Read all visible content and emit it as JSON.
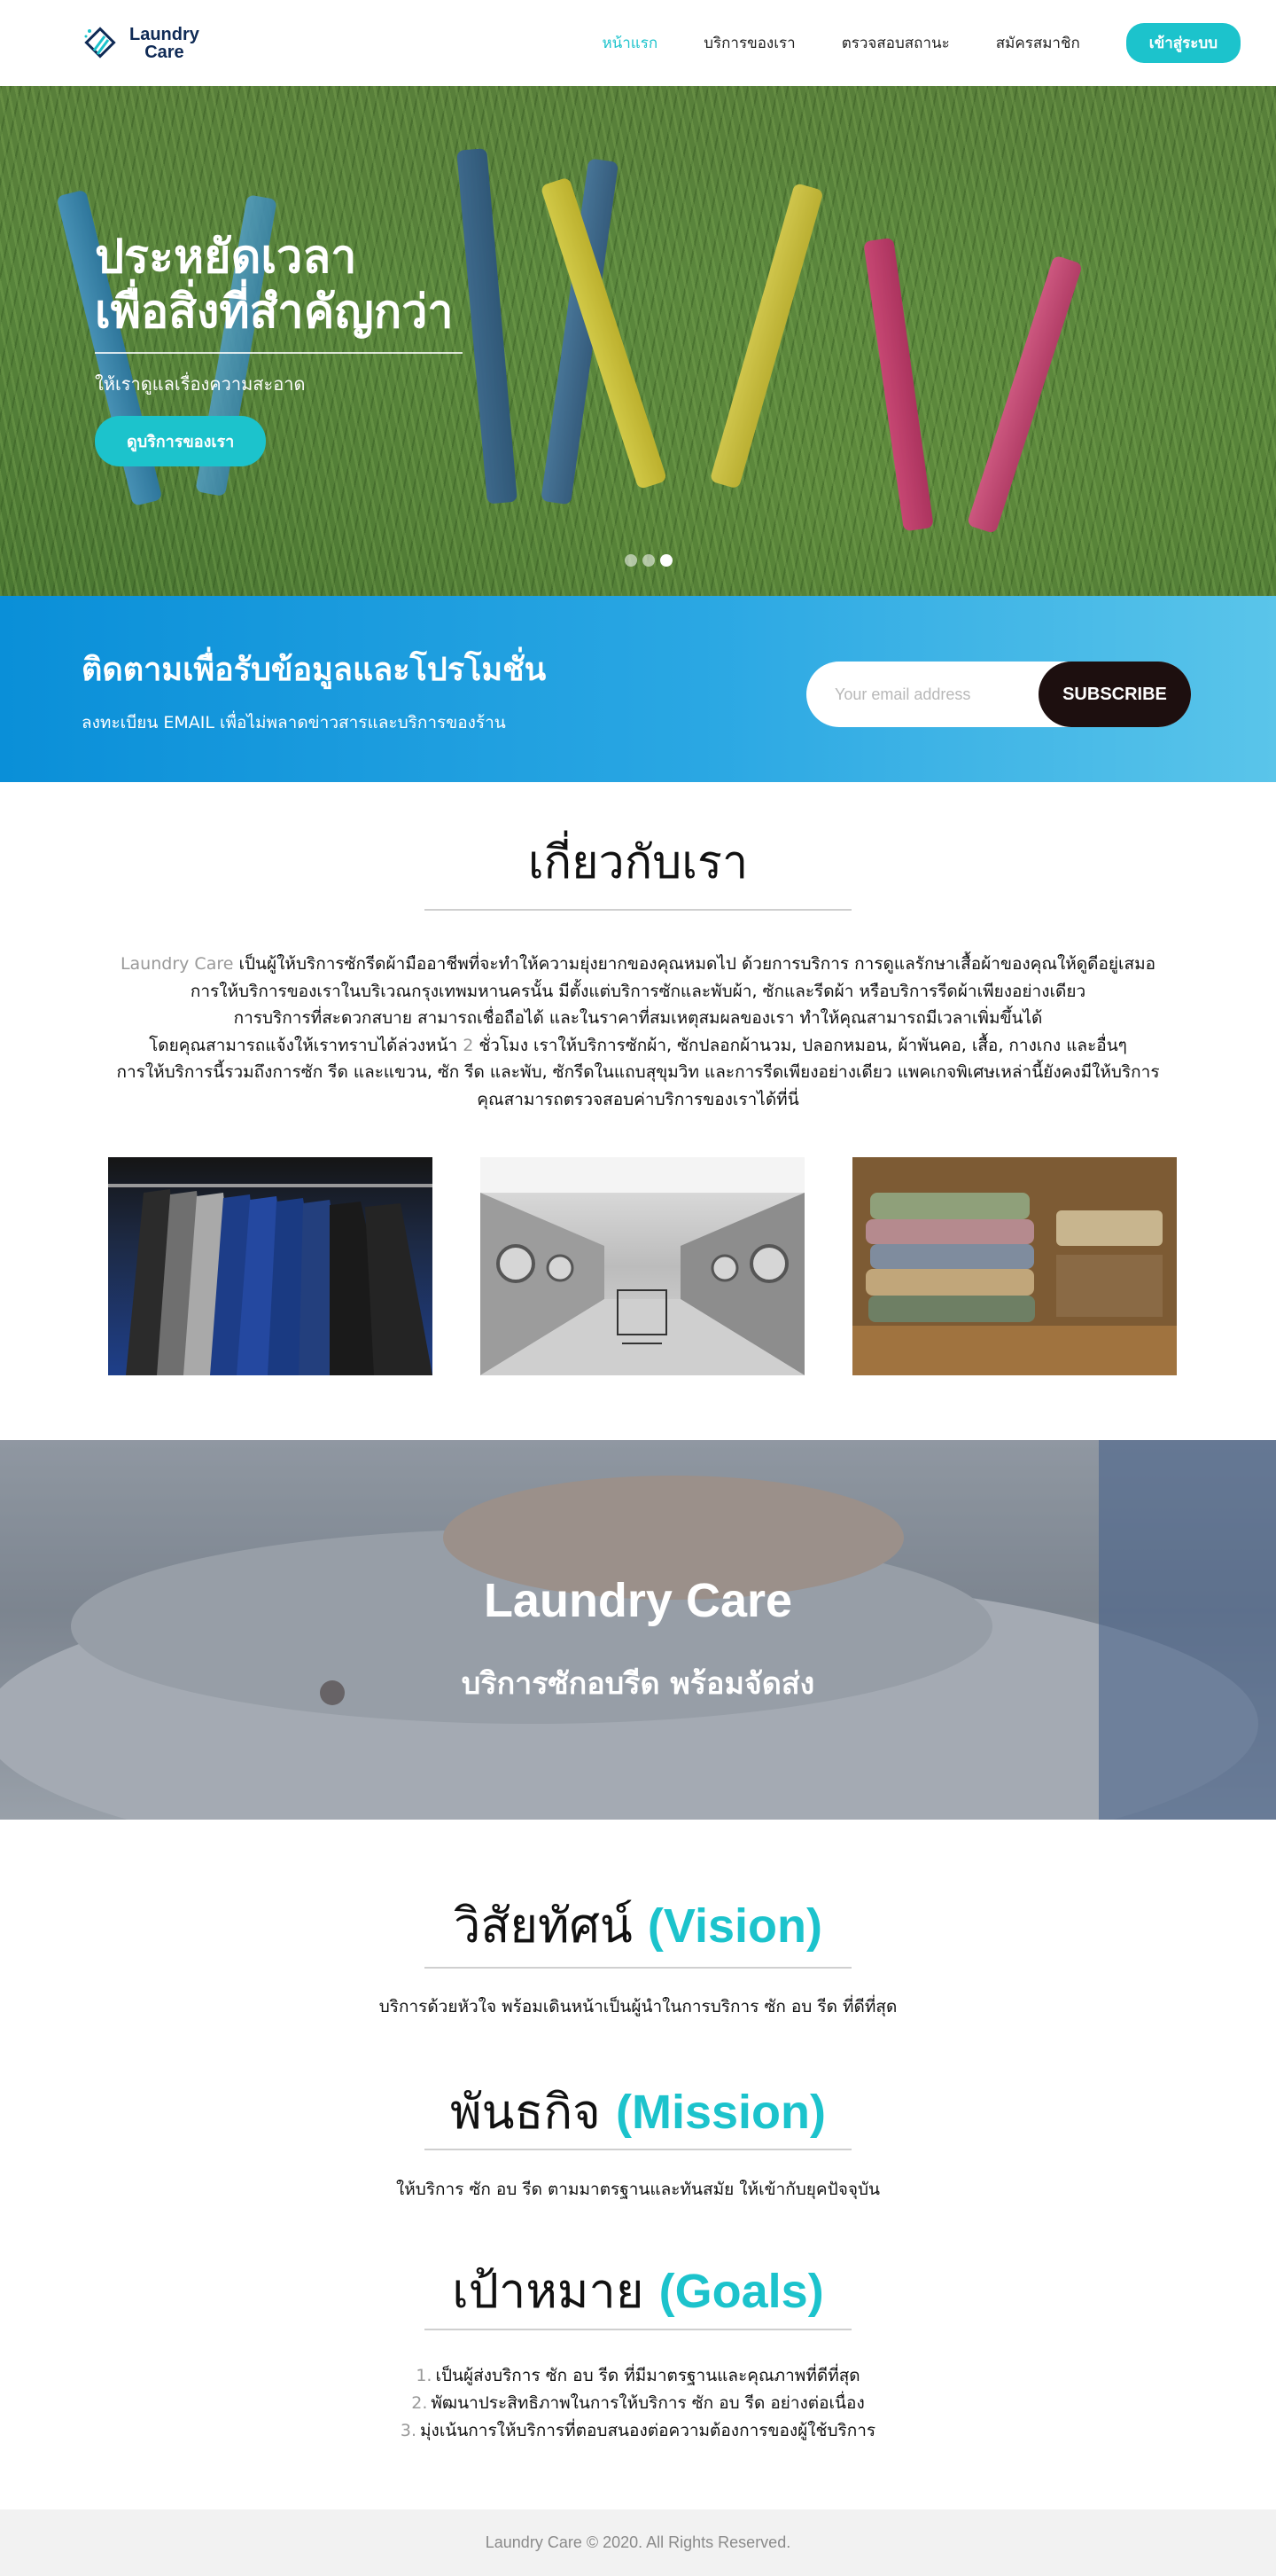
{
  "brand": {
    "line1": "Laundry",
    "line2": "Care",
    "accent_color": "#1cc3cc",
    "navy": "#0f2a55"
  },
  "nav": {
    "items": [
      {
        "label": "หน้าแรก",
        "active": true
      },
      {
        "label": "บริการของเรา",
        "active": false
      },
      {
        "label": "ตรวจสอบสถานะ",
        "active": false
      },
      {
        "label": "สมัครสมาชิก",
        "active": false
      }
    ],
    "login_label": "เข้าสู่ระบบ"
  },
  "hero": {
    "title_line1": "ประหยัดเวลา",
    "title_line2": "เพื่อสิ่งที่สำคัญกว่า",
    "subtitle": "ให้เราดูแลเรื่องความสะอาด",
    "button_label": "ดูบริการของเรา",
    "slides": 3,
    "active_slide": 3
  },
  "subscribe": {
    "title": "ติดตามเพื่อรับข้อมูลและโปรโมชั่น",
    "description": "ลงทะเบียน EMAIL เพื่อไม่พลาดข่าวสารและบริการของร้าน",
    "placeholder": "Your email address",
    "button_label": "SUBSCRIBE"
  },
  "about": {
    "title": "เกี่ยวกับเรา",
    "brand_prefix": "Laundry Care",
    "line1_rest": " เป็นผู้ให้บริการซักรีดผ้ามืออาชีพที่จะทำให้ความยุ่งยากของคุณหมดไป ด้วยการบริการ การดูแลรักษาเสื้อผ้าของคุณให้ดูดีอยู่เสมอ",
    "line2": "การให้บริการของเราในบริเวณกรุงเทพมหานครนั้น มีตั้งแต่บริการซักและพับผ้า, ซักและรีดผ้า หรือบริการรีดผ้าเพียงอย่างเดียว",
    "line3": "การบริการที่สะดวกสบาย สามารถเชื่อถือได้ และในราคาที่สมเหตุสมผลของเรา ทำให้คุณสามารถมีเวลาเพิ่มขึ้นได้",
    "line4_a": "โดยคุณสามารถแจ้งให้เราทราบได้ล่วงหน้า ",
    "line4_num": "2",
    "line4_b": " ชั่วโมง เราให้บริการซักผ้า, ซักปลอกผ้านวม, ปลอกหมอน, ผ้าพันคอ, เสื้อ, กางเกง และอื่นๆ",
    "line5": "การให้บริการนี้รวมถึงการซัก รีด และแขวน, ซัก รีด และพับ, ซักรีดในแถบสุขุมวิท และการรีดเพียงอย่างเดียว แพคเกจพิเศษเหล่านี้ยังคงมีให้บริการ",
    "line6": "คุณสามารถตรวจสอบค่าบริการของเราได้ที่นี่"
  },
  "banner": {
    "title": "Laundry Care",
    "subtitle": "บริการซักอบรีด พร้อมจัดส่ง"
  },
  "vision": {
    "title_th": "วิสัยทัศน์ ",
    "title_en": "(Vision)",
    "text": "บริการด้วยหัวใจ พร้อมเดินหน้าเป็นผู้นำในการบริการ ซัก อบ รีด ที่ดีที่สุด"
  },
  "mission": {
    "title_th": "พันธกิจ ",
    "title_en": "(Mission)",
    "text": "ให้บริการ ซัก อบ รีด ตามมาตรฐานและทันสมัย ให้เข้ากับยุคปัจจุบัน"
  },
  "goals": {
    "title_th": "เป้าหมาย ",
    "title_en": "(Goals)",
    "items": [
      {
        "num": "1.",
        "text": "เป็นผู้ส่งบริการ ซัก อบ รีด ที่มีมาตรฐานและคุณภาพที่ดีที่สุด"
      },
      {
        "num": "2.",
        "text": "พัฒนาประสิทธิภาพในการให้บริการ ซัก อบ รีด อย่างต่อเนื่อง"
      },
      {
        "num": "3.",
        "text": "มุ่งเน้นการให้บริการที่ตอบสนองต่อความต้องการของผู้ใช้บริการ"
      }
    ]
  },
  "footer": {
    "text": "Laundry Care © 2020. All Rights Reserved."
  }
}
